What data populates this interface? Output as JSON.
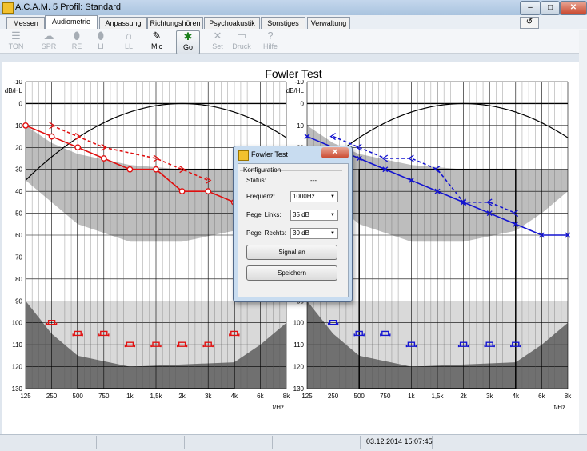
{
  "window": {
    "title": "A.C.A.M. 5  Profil: Standard",
    "btn_min": "–",
    "btn_max": "□",
    "btn_close": "✕"
  },
  "tabs": [
    {
      "label": "Messen",
      "active": false
    },
    {
      "label": "Audiometrie",
      "active": true
    },
    {
      "label": "Anpassung",
      "active": false
    },
    {
      "label": "Richtungshören",
      "active": false
    },
    {
      "label": "Psychoakustik",
      "active": false
    },
    {
      "label": "Sonstiges",
      "active": false
    },
    {
      "label": "Verwaltung",
      "active": false
    }
  ],
  "help_glyph": "↺",
  "toolbar": [
    {
      "label": "TON",
      "icon": "sliders-icon",
      "glyph": "☰",
      "active": false
    },
    {
      "label": "SPR",
      "icon": "speech-icon",
      "glyph": "☁",
      "active": false
    },
    {
      "label": "RE",
      "icon": "ear-right-icon",
      "glyph": "⬮",
      "active": false
    },
    {
      "label": "LI",
      "icon": "ear-left-icon",
      "glyph": "⬮",
      "active": false
    },
    {
      "label": "LL",
      "icon": "headphones-icon",
      "glyph": "∩",
      "active": false
    },
    {
      "label": "Mic",
      "icon": "microphone-icon",
      "glyph": "✎",
      "active": true
    },
    {
      "label": "Go",
      "icon": "go-icon",
      "glyph": "✱",
      "active": true
    },
    {
      "label": "Set",
      "icon": "tools-icon",
      "glyph": "✕",
      "active": false
    },
    {
      "label": "Druck",
      "icon": "printer-icon",
      "glyph": "▭",
      "active": false
    },
    {
      "label": "Hilfe",
      "icon": "help-icon",
      "glyph": "?",
      "active": false
    }
  ],
  "page_title": "Fowler Test",
  "status": {
    "time": "03.12.2014 15:07:45"
  },
  "dialog": {
    "title": "Fowler Test",
    "group": "Konfiguration",
    "status_label": "Status:",
    "status_value": "---",
    "freq_label": "Frequenz:",
    "freq_value": "1000Hz",
    "pegel_links_label": "Pegel Links:",
    "pegel_links_value": "35 dB",
    "pegel_rechts_label": "Pegel Rechts:",
    "pegel_rechts_value": "30 dB",
    "signal_button": "Signal an",
    "save_button": "Speichern"
  },
  "chart_data": [
    {
      "type": "line",
      "side": "right-ear",
      "ylabel": "dB/HL",
      "xlabel": "f/Hz",
      "ylim": [
        -10,
        130
      ],
      "y_inverted": true,
      "y_ticks": [
        "-10",
        "0",
        "10",
        "20",
        "30",
        "40",
        "50",
        "60",
        "70",
        "80",
        "90",
        "100",
        "110",
        "120",
        "130"
      ],
      "x_ticks": [
        "125",
        "250",
        "500",
        "750",
        "1k",
        "1,5k",
        "2k",
        "3k",
        "4k",
        "6k",
        "8k"
      ],
      "color": "#e01010",
      "series": [
        {
          "line": "solid",
          "marker": "circle",
          "x": [
            "125",
            "250",
            "500",
            "750",
            "1k",
            "1,5k",
            "2k",
            "3k",
            "4k"
          ],
          "values": [
            10,
            15,
            20,
            25,
            30,
            30,
            40,
            40,
            45
          ]
        },
        {
          "line": "dashed",
          "marker": "arrow-right",
          "x": [
            "250",
            "500",
            "750",
            "1,5k",
            "2k",
            "3k"
          ],
          "values": [
            10,
            15,
            20,
            25,
            30,
            35
          ]
        }
      ],
      "bone_markers": {
        "x": [
          "250",
          "500",
          "750",
          "1k",
          "1,5k",
          "2k",
          "3k",
          "4k"
        ],
        "values": [
          100,
          105,
          105,
          110,
          110,
          110,
          110,
          105
        ]
      }
    },
    {
      "type": "line",
      "side": "left-ear",
      "ylabel": "dB/HL",
      "xlabel": "f/Hz",
      "ylim": [
        -10,
        130
      ],
      "y_inverted": true,
      "y_ticks": [
        "-10",
        "0",
        "10",
        "20",
        "30",
        "40",
        "50",
        "60",
        "70",
        "80",
        "90",
        "100",
        "110",
        "120",
        "130"
      ],
      "x_ticks": [
        "125",
        "250",
        "500",
        "750",
        "1k",
        "1,5k",
        "2k",
        "3k",
        "4k",
        "6k",
        "8k"
      ],
      "color": "#1414d0",
      "series": [
        {
          "line": "solid",
          "marker": "cross",
          "x": [
            "125",
            "500",
            "750",
            "1k",
            "1,5k",
            "2k",
            "3k",
            "4k",
            "6k",
            "8k"
          ],
          "values": [
            15,
            25,
            30,
            35,
            40,
            45,
            50,
            55,
            60,
            60
          ]
        },
        {
          "line": "dashed",
          "marker": "arrow-left",
          "x": [
            "250",
            "500",
            "750",
            "1k",
            "1,5k",
            "2k",
            "3k",
            "4k"
          ],
          "values": [
            15,
            20,
            25,
            25,
            30,
            45,
            45,
            50
          ]
        }
      ],
      "bone_markers": {
        "x": [
          "250",
          "500",
          "750",
          "1k",
          "2k",
          "3k",
          "4k"
        ],
        "values": [
          100,
          105,
          105,
          110,
          110,
          110,
          110
        ]
      }
    }
  ]
}
